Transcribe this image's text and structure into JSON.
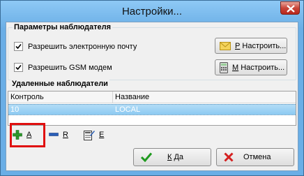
{
  "window": {
    "title": "Настройки..."
  },
  "observer": {
    "group_title": "Параметры наблюдателя",
    "email": {
      "label": "Разрешить электронную почту",
      "checked": true,
      "button": "Р Настроить...",
      "button_key": "Р",
      "button_rest": " Настроить..."
    },
    "gsm": {
      "label": "Разрешить GSM модем",
      "checked": true,
      "button": "М Настроить...",
      "button_key": "М",
      "button_rest": " Настроить..."
    }
  },
  "remote": {
    "group_title": "Удаленные наблюдатели",
    "columns": [
      "Контроль",
      "Название"
    ],
    "rows": [
      {
        "control": "10",
        "name": "LOCAL"
      }
    ]
  },
  "toolbar": {
    "add": "A",
    "remove": "R",
    "edit": "E"
  },
  "footer": {
    "ok_key": "К",
    "ok_rest": " Да",
    "cancel": "Отмена"
  }
}
